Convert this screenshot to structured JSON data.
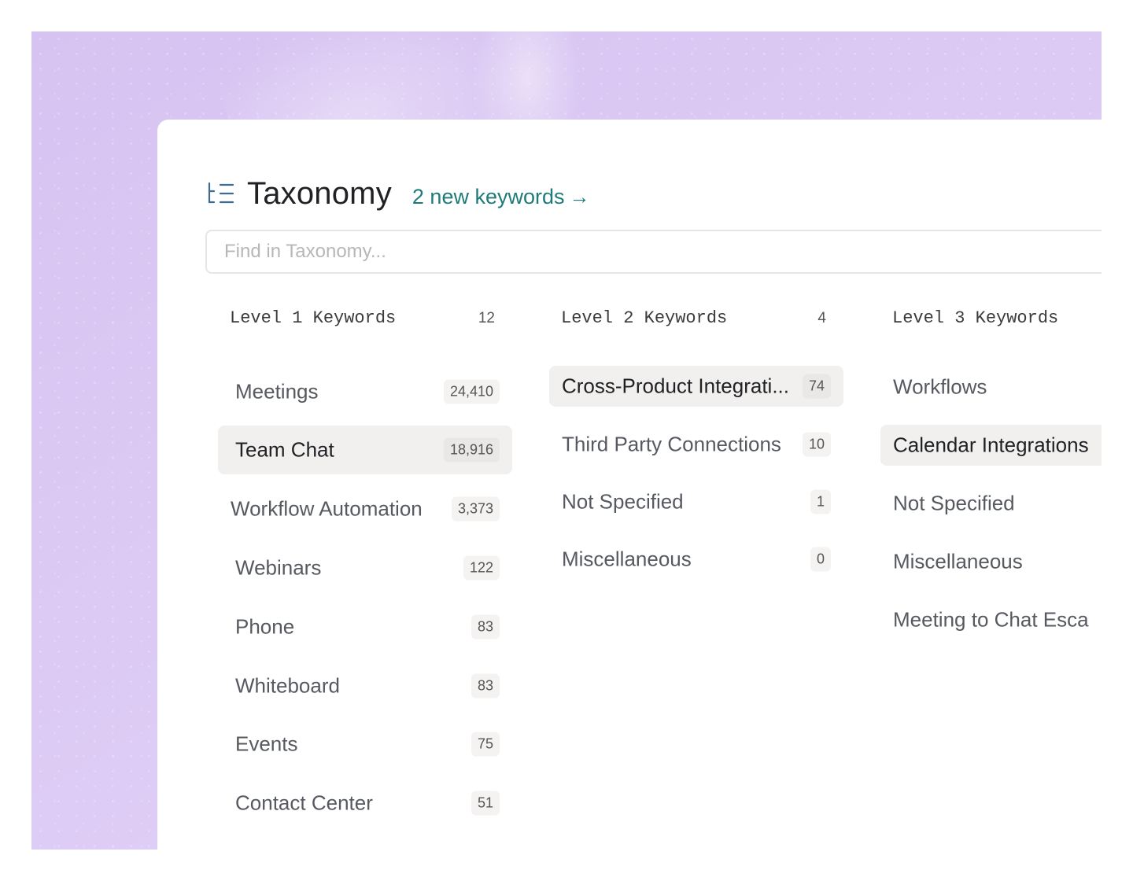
{
  "header": {
    "icon": "taxonomy-icon",
    "title": "Taxonomy",
    "new_link": "2 new keywords",
    "new_link_arrow": "→"
  },
  "search": {
    "placeholder": "Find in Taxonomy..."
  },
  "columns": [
    {
      "title": "Level 1 Keywords",
      "count": "12",
      "items": [
        {
          "label": "Meetings",
          "count": "24,410",
          "selected": false
        },
        {
          "label": "Team Chat",
          "count": "18,916",
          "selected": true
        },
        {
          "label": "Workflow Automation",
          "count": "3,373",
          "selected": false
        },
        {
          "label": "Webinars",
          "count": "122",
          "selected": false
        },
        {
          "label": "Phone",
          "count": "83",
          "selected": false
        },
        {
          "label": "Whiteboard",
          "count": "83",
          "selected": false
        },
        {
          "label": "Events",
          "count": "75",
          "selected": false
        },
        {
          "label": "Contact Center",
          "count": "51",
          "selected": false
        }
      ]
    },
    {
      "title": "Level 2 Keywords",
      "count": "4",
      "items": [
        {
          "label": "Cross-Product Integrati...",
          "count": "74",
          "selected": true
        },
        {
          "label": "Third Party Connections",
          "count": "10",
          "selected": false
        },
        {
          "label": "Not Specified",
          "count": "1",
          "selected": false
        },
        {
          "label": "Miscellaneous",
          "count": "0",
          "selected": false
        }
      ]
    },
    {
      "title": "Level 3 Keywords",
      "count": "",
      "items": [
        {
          "label": "Workflows",
          "selected": false
        },
        {
          "label": "Calendar Integrations",
          "selected": true
        },
        {
          "label": "Not Specified",
          "selected": false
        },
        {
          "label": "Miscellaneous",
          "selected": false
        },
        {
          "label": "Meeting to Chat Esca",
          "selected": false
        }
      ]
    }
  ],
  "colors": {
    "accent_link": "#1f7a7a",
    "selected_bg": "#f1f0ef",
    "backdrop": "#dccaf4"
  }
}
